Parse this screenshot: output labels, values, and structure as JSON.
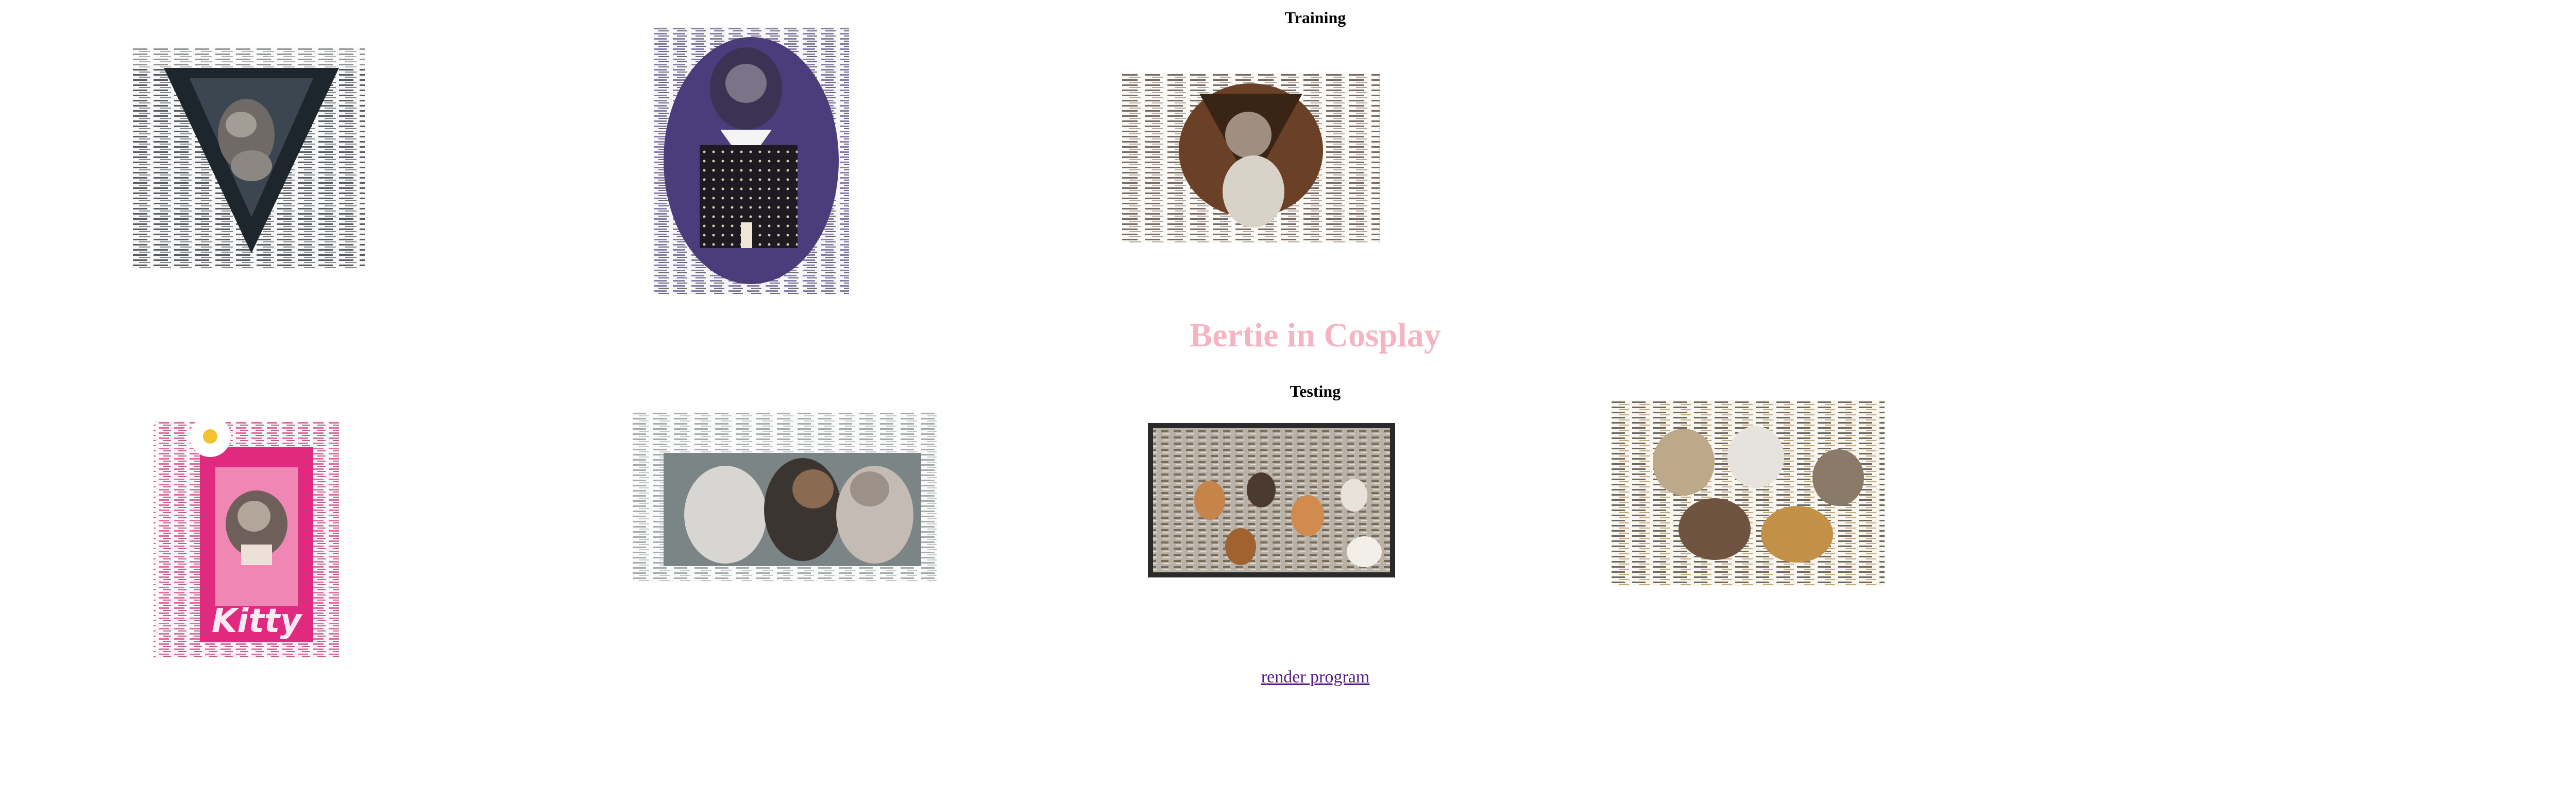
{
  "page": {
    "training_heading": "Training",
    "title": "Bertie in Cosplay",
    "testing_heading": "Testing",
    "link_label": "render program"
  },
  "colors": {
    "title": "#f4b5c3",
    "link": "#551a8b",
    "heading": "#000000"
  },
  "training_images": [
    {
      "name": "training-image-1",
      "subject": "cat in dark triangular costume"
    },
    {
      "name": "training-image-2",
      "subject": "cat in black dress with white collar"
    },
    {
      "name": "training-image-3",
      "subject": "cat in brown hood"
    }
  ],
  "testing_images": [
    {
      "name": "testing-image-1",
      "subject": "cat in pink doll box",
      "box_text": "Kitty"
    },
    {
      "name": "testing-image-2",
      "subject": "group of cats"
    },
    {
      "name": "testing-image-3",
      "subject": "many cats photo"
    },
    {
      "name": "testing-image-4",
      "subject": "cat collage"
    }
  ]
}
